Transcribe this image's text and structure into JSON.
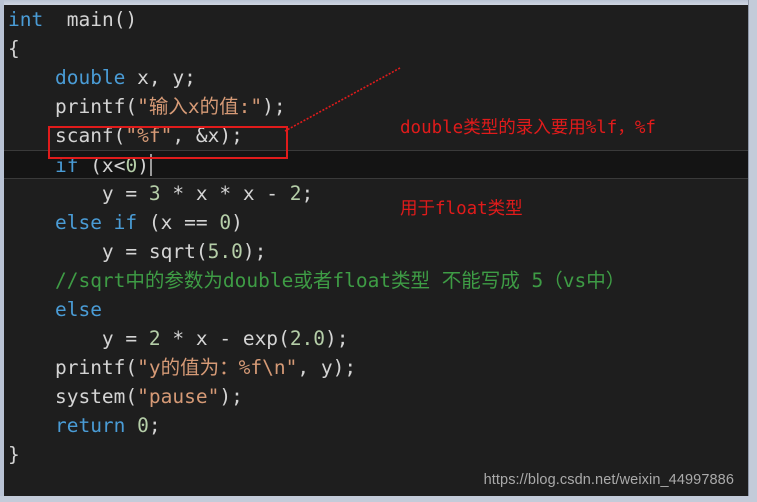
{
  "window": {
    "title": "C source code editor",
    "theme": "dark"
  },
  "colors": {
    "background": "#1e1e1e",
    "keyword": "#4a9cd6",
    "string": "#d69a76",
    "number": "#b5cea8",
    "comment": "#3e9c45",
    "plain": "#d4d4d4",
    "annotation": "#e01b1b",
    "current_line": "#141414",
    "chrome": "#c3cbd9"
  },
  "code": {
    "lines": [
      {
        "id": "line-1",
        "indent": 0,
        "current": false,
        "tokens": [
          {
            "cls": "kw",
            "text": "int"
          },
          {
            "cls": "pln",
            "text": "  "
          },
          {
            "cls": "fn",
            "text": "main"
          },
          {
            "cls": "punc",
            "text": "()"
          }
        ]
      },
      {
        "id": "line-2",
        "indent": 0,
        "current": false,
        "tokens": [
          {
            "cls": "punc",
            "text": "{"
          }
        ]
      },
      {
        "id": "line-3",
        "indent": 2,
        "current": false,
        "tokens": [
          {
            "cls": "kw",
            "text": "double"
          },
          {
            "cls": "pln",
            "text": " x, y;"
          }
        ]
      },
      {
        "id": "line-4",
        "indent": 2,
        "current": false,
        "tokens": [
          {
            "cls": "fn",
            "text": "printf"
          },
          {
            "cls": "punc",
            "text": "("
          },
          {
            "cls": "str",
            "text": "\"输入x的值:\""
          },
          {
            "cls": "punc",
            "text": ");"
          }
        ]
      },
      {
        "id": "line-5",
        "indent": 2,
        "current": false,
        "tokens": [
          {
            "cls": "fn",
            "text": "scanf"
          },
          {
            "cls": "punc",
            "text": "("
          },
          {
            "cls": "str",
            "text": "\"%f\""
          },
          {
            "cls": "punc",
            "text": ", &x);"
          }
        ]
      },
      {
        "id": "line-6",
        "indent": 2,
        "current": true,
        "caret": true,
        "tokens": [
          {
            "cls": "kw",
            "text": "if"
          },
          {
            "cls": "pln",
            "text": " (x"
          },
          {
            "cls": "punc",
            "text": "<"
          },
          {
            "cls": "num",
            "text": "0"
          },
          {
            "cls": "punc",
            "text": ")"
          }
        ]
      },
      {
        "id": "line-7",
        "indent": 4,
        "current": false,
        "tokens": [
          {
            "cls": "pln",
            "text": "y = "
          },
          {
            "cls": "num",
            "text": "3"
          },
          {
            "cls": "pln",
            "text": " * x * x - "
          },
          {
            "cls": "num",
            "text": "2"
          },
          {
            "cls": "punc",
            "text": ";"
          }
        ]
      },
      {
        "id": "line-8",
        "indent": 2,
        "current": false,
        "tokens": [
          {
            "cls": "kw",
            "text": "else if"
          },
          {
            "cls": "pln",
            "text": " (x == "
          },
          {
            "cls": "num",
            "text": "0"
          },
          {
            "cls": "punc",
            "text": ")"
          }
        ]
      },
      {
        "id": "line-9",
        "indent": 4,
        "current": false,
        "tokens": [
          {
            "cls": "pln",
            "text": "y = "
          },
          {
            "cls": "fn",
            "text": "sqrt"
          },
          {
            "cls": "punc",
            "text": "("
          },
          {
            "cls": "num",
            "text": "5.0"
          },
          {
            "cls": "punc",
            "text": ");"
          }
        ]
      },
      {
        "id": "line-10",
        "indent": 2,
        "current": false,
        "tokens": [
          {
            "cls": "cmt",
            "text": "//sqrt中的参数为double或者float类型 不能写成 5（vs中）"
          }
        ]
      },
      {
        "id": "line-11",
        "indent": 2,
        "current": false,
        "tokens": [
          {
            "cls": "kw",
            "text": "else"
          }
        ]
      },
      {
        "id": "line-12",
        "indent": 4,
        "current": false,
        "tokens": [
          {
            "cls": "pln",
            "text": "y = "
          },
          {
            "cls": "num",
            "text": "2"
          },
          {
            "cls": "pln",
            "text": " * x - "
          },
          {
            "cls": "fn",
            "text": "exp"
          },
          {
            "cls": "punc",
            "text": "("
          },
          {
            "cls": "num",
            "text": "2.0"
          },
          {
            "cls": "punc",
            "text": ");"
          }
        ]
      },
      {
        "id": "line-13",
        "indent": 2,
        "current": false,
        "tokens": [
          {
            "cls": "fn",
            "text": "printf"
          },
          {
            "cls": "punc",
            "text": "("
          },
          {
            "cls": "str",
            "text": "\"y的值为：%f\\n\""
          },
          {
            "cls": "punc",
            "text": ", y);"
          }
        ]
      },
      {
        "id": "line-14",
        "indent": 2,
        "current": false,
        "tokens": [
          {
            "cls": "fn",
            "text": "system"
          },
          {
            "cls": "punc",
            "text": "("
          },
          {
            "cls": "str",
            "text": "\"pause\""
          },
          {
            "cls": "punc",
            "text": ");"
          }
        ]
      },
      {
        "id": "line-15",
        "indent": 2,
        "current": false,
        "tokens": [
          {
            "cls": "kw",
            "text": "return"
          },
          {
            "cls": "pln",
            "text": " "
          },
          {
            "cls": "num",
            "text": "0"
          },
          {
            "cls": "punc",
            "text": ";"
          }
        ]
      },
      {
        "id": "line-16",
        "indent": 0,
        "current": false,
        "tokens": [
          {
            "cls": "punc",
            "text": "}"
          }
        ]
      }
    ]
  },
  "annotation": {
    "line1": "double类型的录入要用%lf，%f",
    "line2": "用于float类型",
    "color": "#e01b1b",
    "highlight_target": "scanf(\"%f\", &x);"
  },
  "watermark": {
    "text": "https://blog.csdn.net/weixin_44997886"
  }
}
